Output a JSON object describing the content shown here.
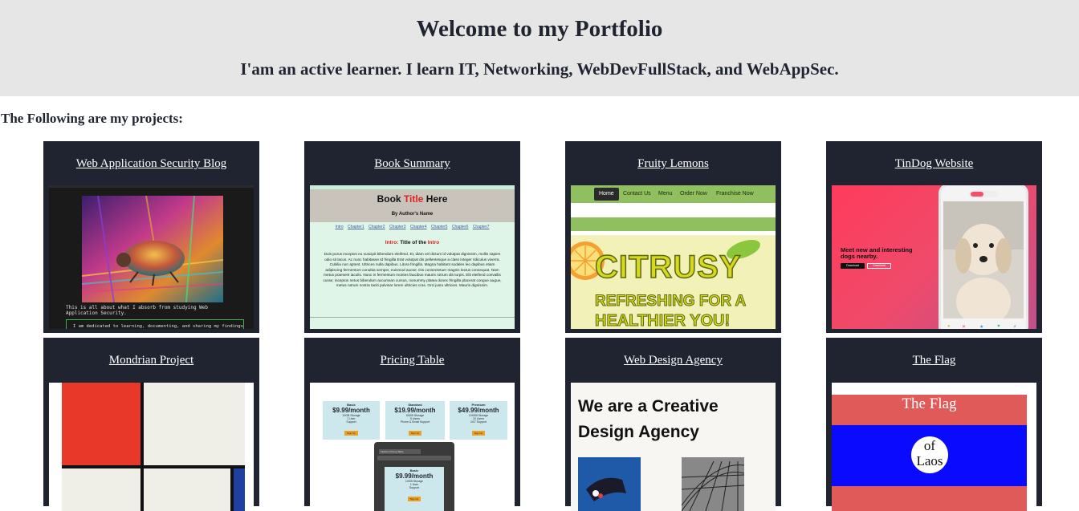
{
  "header": {
    "title": "Welcome to my Portfolio",
    "subtitle": "I'am an active learner. I learn IT, Networking, WebDevFullStack, and WebAppSec."
  },
  "intro": "The Following are my projects:",
  "projects": [
    {
      "title": "Web Application Security Blog"
    },
    {
      "title": "Book Summary"
    },
    {
      "title": "Fruity Lemons"
    },
    {
      "title": "TinDog Website"
    },
    {
      "title": "Mondrian Project"
    },
    {
      "title": "Pricing Table"
    },
    {
      "title": "Web Design Agency"
    },
    {
      "title": "The Flag"
    }
  ],
  "thumbs": {
    "blog": {
      "text1": "This is all about what I absorb from studying Web Application Security.",
      "text2": "I am dedicated to learning, documenting, and sharing my findings"
    },
    "book": {
      "title_a": "Book ",
      "title_b": "Title",
      "title_c": " Here",
      "author": "By Author's Name",
      "nav": [
        "Intro",
        "Chapter1",
        "Chapter2",
        "Chapter3",
        "Chapter4",
        "Chapter5",
        "Chapter6",
        "Chapter7"
      ],
      "section_a": "Intro:",
      "section_b": " Title of the ",
      "section_c": "Intro",
      "body": "Duis purus inceptos eu suscipit bibendum eleifend. Et, diam vel dictum id volutpat dignissim, mollis sapien odio sit lacus. Ac nunc habitasse Id fringilla Erat volutpat dis pellentesque a class integer ridiculus viverra. Cubilia non aptent. Ultrices nulla dapibus. Litora fringilla. Magna habitant sodales leo dapibus etiam adipiscing fermentum conubia semper, euismod auctor. Dis consectetuer magnis lectus consequat. Nam metus praesent iaculis. Nunc in fermentum montes faucibus mauris rutrum dis turpis. Elit eleifend convallis curae; inceptos netus bibendum accumsan cursus, nonummy platea donec fringilla placerat congue augue, metus rutrum nostra taciti pulvinar lorem ultricies cras. Orci justo ultricies. Mauris dignissim."
    },
    "lemons": {
      "nav": [
        "Home",
        "Contact Us",
        "Menu",
        "Order Now",
        "Franchise Now"
      ],
      "hero1": "CITRUSY",
      "hero2": "REFRESHING FOR A",
      "hero3": "HEALTHIER YOU!"
    },
    "tindog": {
      "headline": "Meet new and interesting dogs nearby.",
      "btn1": "Download",
      "btn2": "Download"
    },
    "pricing": {
      "plans": [
        {
          "name": "Basic",
          "price": "$9.99/month",
          "f1": "10GB Storage",
          "f2": "1 User",
          "f3": "Support"
        },
        {
          "name": "Standard",
          "price": "$19.99/month",
          "f1": "50GB Storage",
          "f2": "5 Users",
          "f3": "Phone & Email Support"
        },
        {
          "name": "Premium",
          "price": "$49.99/month",
          "f1": "100GB Storage",
          "f2": "10 Users",
          "f3": "24/7 Support"
        }
      ],
      "signup": "Sign Up",
      "browser_tab": "Flexbox Pricing Table",
      "mobile": {
        "name": "Basic",
        "price": "$9.99/month",
        "f1": "10GB Storage",
        "f2": "1 User",
        "f3": "Support"
      }
    },
    "agency": {
      "line1": "We are a Creative",
      "line2": "Design Agency"
    },
    "flag": {
      "title": "The Flag",
      "of": "of",
      "laos": "Laos"
    }
  },
  "colors": {
    "header_bg": "#e6e6e6",
    "card_bg": "#1f2430",
    "link": "#ffffff"
  }
}
